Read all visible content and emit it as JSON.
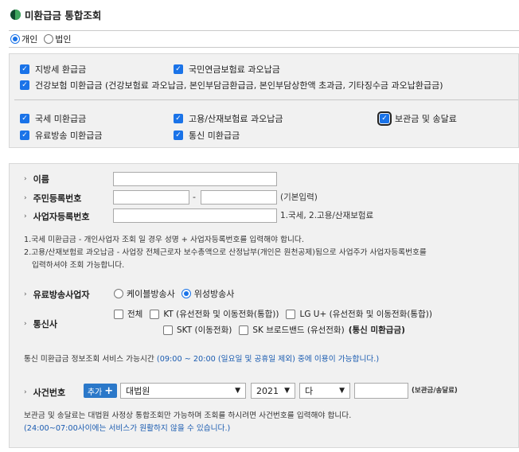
{
  "title": "미환급금 통합조회",
  "user_type": {
    "options": [
      "개인",
      "법인"
    ],
    "selected": "개인"
  },
  "categories": {
    "row1": [
      {
        "label": "지방세 환급금",
        "checked": true
      },
      {
        "label": "국민연금보험료 과오납금",
        "checked": true
      }
    ],
    "row2": {
      "label": "건강보험 미환급금 (건강보험료 과오납금, 본인부담금환급금, 본인부담상한액 초과금, 기타징수금 과오납환급금)",
      "checked": true
    },
    "row3": [
      {
        "label": "국세 미환급금",
        "checked": true
      },
      {
        "label": "고용/산재보험료 과오납금",
        "checked": true
      },
      {
        "label": "보관금 및 송달료",
        "checked": true
      }
    ],
    "row4": [
      {
        "label": "유료방송 미환급금",
        "checked": true
      },
      {
        "label": "통신 미환급금",
        "checked": true
      }
    ]
  },
  "form": {
    "name_label": "이름",
    "rrn_label": "주민등록번호",
    "rrn_separator": "-",
    "rrn_hint": "(기본입력)",
    "biz_label": "사업자등록번호",
    "biz_hint": "1.국세, 2.고용/산재보험료",
    "note1": "1.국세 미환급금 - 개인사업자 조회 일 경우 성명 + 사업자등록번호를 입력해야 합니다.",
    "note2a": "2.고용/산재보험료 과오납금 - 사업장 전체근로자 보수총액으로 산정납부(개인은 원천공제)됨으로 사업주가 사업자등록번호를",
    "note2b": "입력하셔야 조회 가능합니다.",
    "broadcast_label": "유료방송사업자",
    "broadcast_options": [
      {
        "label": "케이블방송사",
        "selected": false
      },
      {
        "label": "위성방송사",
        "selected": true
      }
    ],
    "telecom_label": "통신사",
    "telecom_row1": [
      {
        "label": "전체",
        "checked": false
      },
      {
        "label": "KT (유선전화 및 이동전화(통합))",
        "checked": false
      },
      {
        "label": "LG U+ (유선전화 및 이동전화(통합))",
        "checked": false
      }
    ],
    "telecom_row2": [
      {
        "label": "SKT (이동전화)",
        "checked": false
      },
      {
        "label": "SK 브로드밴드 (유선전화)",
        "checked": false
      }
    ],
    "telecom_row2_bold": "(통신 미환급금)",
    "telecom_note_prefix": "통신 미환급금 정보조회 서비스 가능시간 ",
    "telecom_note_blue": "(09:00 ~ 20:00 (일요일 및 공휴일 제외) 중에 이용이 가능합니다.)",
    "case_label": "사건번호",
    "add_button": "추가",
    "court_select": "대법원",
    "year_select": "2021",
    "case_type_select": "다",
    "case_hint": "(보관금/송달료)",
    "note3": "보관금 및 송달료는 대법원 사정상 통합조회만 가능하며 조회를 하시려면 사건번호를 입력해야 합니다.",
    "note4": "(24:00~07:00사이에는 서비스가 원활하지 않을 수 있습니다.)"
  }
}
